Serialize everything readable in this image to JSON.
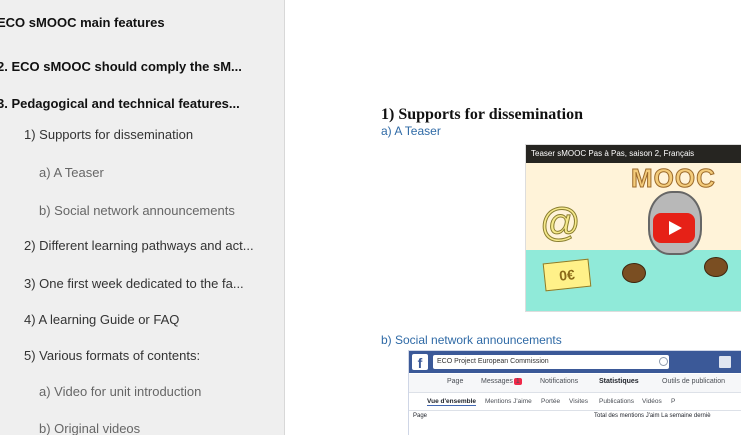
{
  "sidebar": {
    "items": [
      {
        "label": "ECO sMOOC main features"
      },
      {
        "label": "2. ECO sMOOC should comply the sM..."
      },
      {
        "label": "3. Pedagogical and technical features..."
      },
      {
        "label": "1) Supports for dissemination"
      },
      {
        "label": "a) A Teaser"
      },
      {
        "label": "b) Social network announcements"
      },
      {
        "label": "2) Different learning pathways and act..."
      },
      {
        "label": "3) One first week dedicated to the fa..."
      },
      {
        "label": "4) A learning Guide or FAQ"
      },
      {
        "label": "5) Various formats of contents:"
      },
      {
        "label": "a) Video for unit introduction"
      },
      {
        "label": "b) Original videos"
      }
    ]
  },
  "content": {
    "heading": "1) Supports for dissemination",
    "sub_teaser": "a) A Teaser",
    "sub_social": "b) Social network announcements"
  },
  "video": {
    "title": "Teaser sMOOC Pas à Pas, saison 2, Français",
    "mooc_text": "MOOC",
    "at_sign": "@",
    "price": "0€",
    "colors": {
      "play": "#e62117",
      "sea": "#90ead9"
    }
  },
  "facebook": {
    "logo": "f",
    "search_value": "ECO Project European Commission",
    "menu": [
      "Page",
      "Messages",
      "Notifications",
      "Statistiques",
      "Outils de publication"
    ],
    "messages_badge": "1",
    "tabs": [
      "Vue d'ensemble",
      "Mentions J'aime",
      "Portée",
      "Visites",
      "Publications",
      "Vidéos",
      "P"
    ],
    "row_label": "Page",
    "row_text": "Total des mentions J'aim  La semaine derniè",
    "brand_color": "#3b5998"
  }
}
